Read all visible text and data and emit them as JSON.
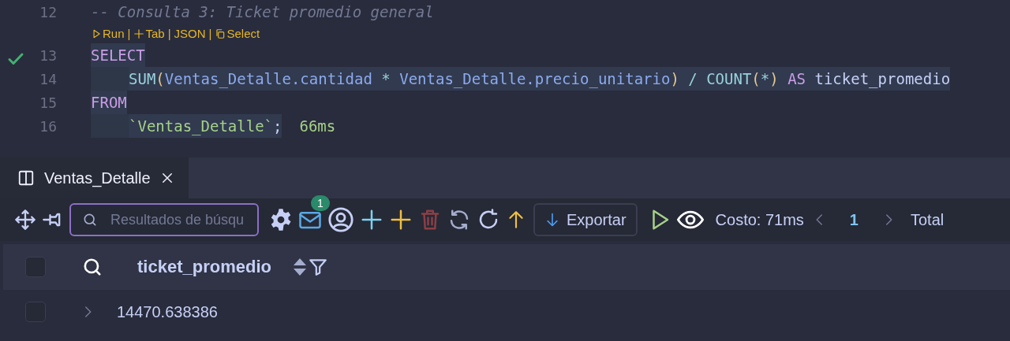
{
  "editor": {
    "lines": [
      {
        "number": "12",
        "checked": false,
        "selected": false,
        "indent": false,
        "tokens": [
          {
            "kind": "comment",
            "text": "-- Consulta 3: Ticket promedio general"
          }
        ]
      },
      {
        "number": "13",
        "checked": true,
        "selected": true,
        "indent": false,
        "tokens": [
          {
            "kind": "keyword",
            "text": "SELECT"
          }
        ]
      },
      {
        "number": "14",
        "checked": false,
        "selected": true,
        "indent": true,
        "tokens": [
          {
            "kind": "function",
            "text": "SUM"
          },
          {
            "kind": "paren",
            "text": "("
          },
          {
            "kind": "ident",
            "text": "Ventas_Detalle.cantidad "
          },
          {
            "kind": "function",
            "text": "* "
          },
          {
            "kind": "ident",
            "text": "Ventas_Detalle.precio_unitario"
          },
          {
            "kind": "paren",
            "text": ")"
          },
          {
            "kind": "function",
            "text": " / COUNT"
          },
          {
            "kind": "paren",
            "text": "("
          },
          {
            "kind": "function",
            "text": "*"
          },
          {
            "kind": "paren",
            "text": ")"
          },
          {
            "kind": "keyword",
            "text": " AS"
          },
          {
            "kind": "plain",
            "text": " ticket_promedio"
          }
        ]
      },
      {
        "number": "15",
        "checked": false,
        "selected": true,
        "indent": false,
        "tokens": [
          {
            "kind": "keyword",
            "text": "FROM"
          }
        ]
      },
      {
        "number": "16",
        "checked": false,
        "selected": true,
        "indent": true,
        "tokens": [
          {
            "kind": "string",
            "text": "`Ventas_Detalle`"
          },
          {
            "kind": "plain",
            "text": ";"
          }
        ],
        "duration": "66ms"
      }
    ],
    "codelens": [
      {
        "kind": "run",
        "label": "Run"
      },
      {
        "kind": "separator",
        "label": "|"
      },
      {
        "kind": "tab",
        "label": "Tab"
      },
      {
        "kind": "separator",
        "label": "|"
      },
      {
        "kind": "plain",
        "label": "JSON"
      },
      {
        "kind": "separator",
        "label": "|"
      },
      {
        "kind": "copy",
        "label": "Select"
      }
    ]
  },
  "tabs": [
    {
      "label": "Ventas_Detalle",
      "selected": true
    }
  ],
  "toolbar": {
    "search": {
      "placeholder": "Resultados de búsqu"
    },
    "badge": "1",
    "export_button": "Exportar",
    "cost": "Costo: 71ms",
    "page": "1",
    "total": "Total"
  },
  "table": {
    "columns": [
      {
        "label": "ticket_promedio"
      }
    ],
    "header_checked": false,
    "rows": [
      {
        "checked": false,
        "expanded": false,
        "cells": [
          "14470.638386"
        ]
      }
    ]
  }
}
